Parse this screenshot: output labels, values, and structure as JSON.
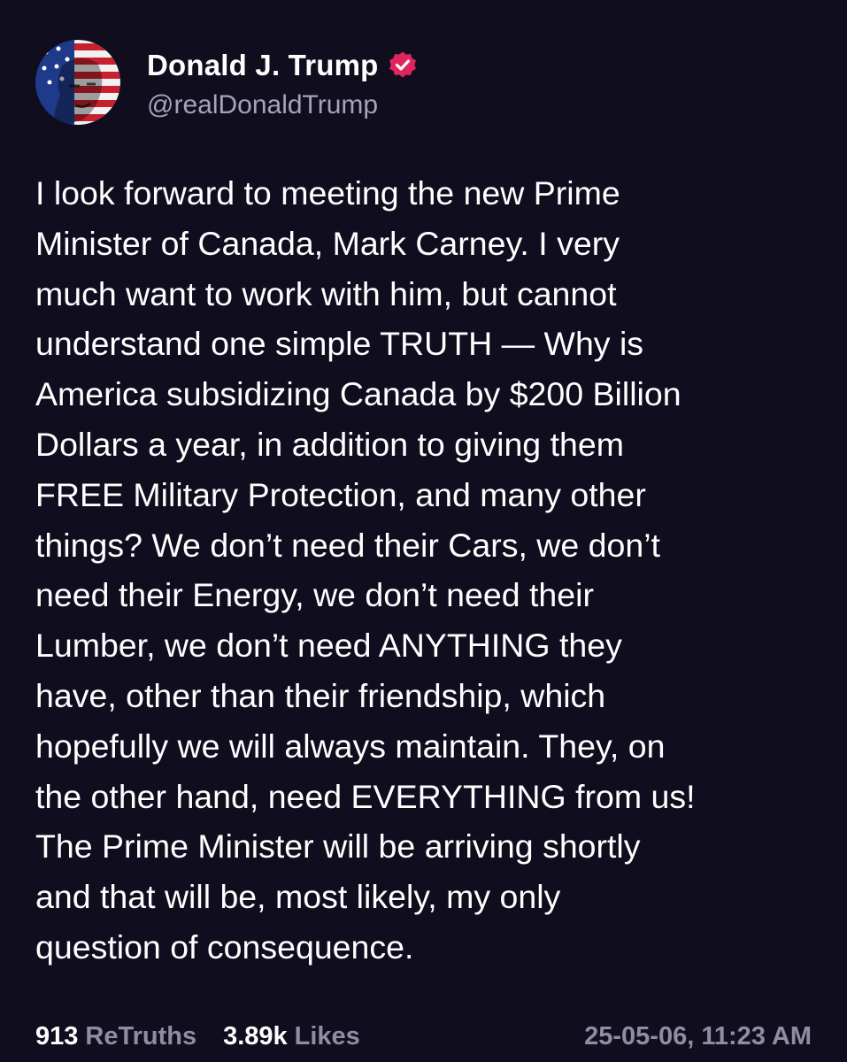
{
  "author": {
    "display_name": "Donald J. Trump",
    "handle": "@realDonaldTrump",
    "verified": true,
    "avatar_icon": "flag-portrait-avatar",
    "verified_icon": "verified-badge-icon",
    "verified_color": "#e0245e"
  },
  "post": {
    "lines": [
      "I look forward to meeting the new Prime",
      "Minister of Canada, Mark Carney. I very",
      "much want to work with him, but cannot",
      "understand one simple TRUTH — Why is",
      "America subsidizing Canada by $200 Billion",
      "Dollars a year, in addition to giving them",
      "FREE Military Protection, and many other",
      "things? We don’t need their Cars, we don’t",
      "need their Energy, we don’t need their",
      "Lumber, we don’t need ANYTHING they",
      "have, other than their friendship, which",
      "hopefully we will always maintain. They, on",
      "the other hand, need EVERYTHING from us!",
      "The Prime Minister will be arriving shortly",
      "and that will be, most likely, my only",
      "question of consequence."
    ]
  },
  "stats": {
    "retruths_count": "913",
    "retruths_label": "ReTruths",
    "likes_count": "3.89k",
    "likes_label": "Likes",
    "timestamp": "25-05-06, 11:23 AM"
  },
  "colors": {
    "background": "#0f0d1e",
    "text": "#ffffff",
    "muted": "#8f8da3"
  }
}
